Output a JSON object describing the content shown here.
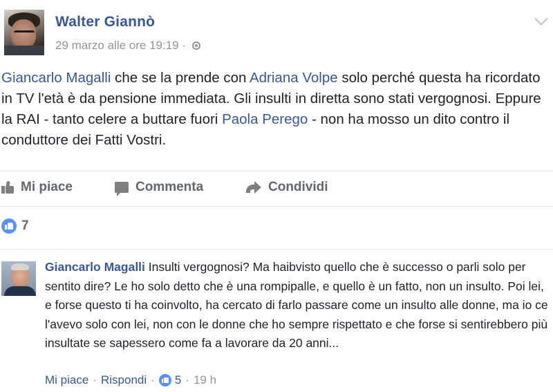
{
  "post": {
    "author": "Walter Giannò",
    "timestamp": "29 marzo alle ore 19:19 ·",
    "privacy_icon": "globe-icon",
    "text_segments": [
      {
        "text": "Giancarlo Magalli",
        "mention": true
      },
      {
        "text": " che se la prende con ",
        "mention": false
      },
      {
        "text": "Adriana Volpe",
        "mention": true
      },
      {
        "text": " solo perché questa ha ricordato in TV l'età è da pensione immediata. Gli insulti in diretta sono stati vergognosi. Eppure la RAI - tanto celere a buttare fuori ",
        "mention": false
      },
      {
        "text": "Paola Perego",
        "mention": true
      },
      {
        "text": " - non ha mosso un dito contro il conduttore dei Fatti Vostri.",
        "mention": false
      }
    ]
  },
  "actions": {
    "like_label": "Mi piace",
    "comment_label": "Commenta",
    "share_label": "Condividi"
  },
  "reactions": {
    "count": "7",
    "icon": "like-reaction-icon"
  },
  "comment": {
    "author": "Giancarlo Magalli",
    "text": "Insulti vergognosi? Ma haibvisto quello che è successo o parli solo per sentito dire? Le ho solo detto che è una rompipalle, e quello è un fatto, non un insulto. Poi lei, e forse questo ti ha coinvolto, ha cercato di farlo passare come un insulto alle donne, ma io ce l'avevo solo con lei, non con le donne che ho sempre rispettato e che forse si sentirebbero più insultate se sapessero come fa a lavorare da 20 anni...",
    "like_link": "Mi piace",
    "reply_link": "Rispondi",
    "separator": "·",
    "like_count": "5",
    "age": "19 h"
  },
  "colors": {
    "link": "#365899",
    "meta": "#90949c",
    "text": "#1d2129",
    "reaction_blue": "#5890ff"
  }
}
